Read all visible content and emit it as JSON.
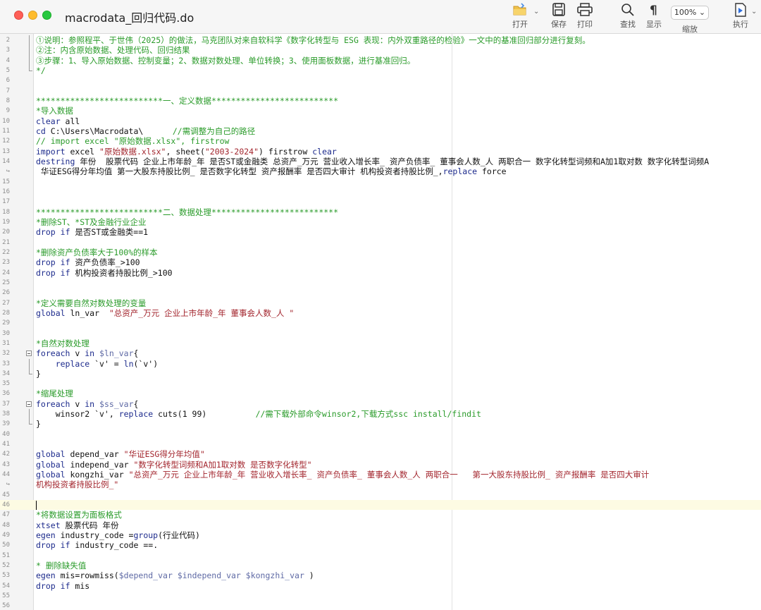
{
  "window": {
    "title": "macrodata_回归代码.do"
  },
  "toolbar": {
    "open": "打开",
    "save": "保存",
    "print": "打印",
    "find": "查找",
    "show": "显示",
    "zoom_label": "缩放",
    "zoom_value": "100%",
    "execute": "执行"
  },
  "lines": [
    {
      "n": "2",
      "segs": [
        {
          "t": "①说明：参照程平、于世伟（2025）的做法，马克团队对来自软科学《数字化转型与 ESG 表现：内外双重路径的检验》一文中的基准回归部分进行复刻。",
          "c": "c"
        }
      ]
    },
    {
      "n": "3",
      "segs": [
        {
          "t": "②注：内含原始数据、处理代码、回归结果",
          "c": "c"
        }
      ]
    },
    {
      "n": "4",
      "segs": [
        {
          "t": "③步骤：1、导入原始数据、控制变量；2、数据对数处理、单位转换；3、使用面板数据，进行基准回归。",
          "c": "c"
        }
      ]
    },
    {
      "n": "5",
      "segs": [
        {
          "t": "*/",
          "c": "c"
        }
      ]
    },
    {
      "n": "6",
      "segs": []
    },
    {
      "n": "7",
      "segs": []
    },
    {
      "n": "8",
      "segs": [
        {
          "t": "**************************一、定义数据**************************",
          "c": "c"
        }
      ]
    },
    {
      "n": "9",
      "segs": [
        {
          "t": "*导入数据",
          "c": "c"
        }
      ]
    },
    {
      "n": "10",
      "segs": [
        {
          "t": "clear",
          "c": "k"
        },
        {
          "t": " all",
          "c": "p"
        }
      ]
    },
    {
      "n": "11",
      "segs": [
        {
          "t": "cd",
          "c": "k"
        },
        {
          "t": " C:\\Users\\Macrodata\\      ",
          "c": "p"
        },
        {
          "t": "//需调整为自己的路径",
          "c": "c"
        }
      ]
    },
    {
      "n": "12",
      "segs": [
        {
          "t": "// import excel \"原始数据.xlsx\", firstrow",
          "c": "c"
        }
      ]
    },
    {
      "n": "13",
      "segs": [
        {
          "t": "import",
          "c": "k"
        },
        {
          "t": " excel ",
          "c": "p"
        },
        {
          "t": "\"原始数据.xlsx\"",
          "c": "s"
        },
        {
          "t": ", sheet(",
          "c": "p"
        },
        {
          "t": "\"2003-2024\"",
          "c": "s"
        },
        {
          "t": ") firstrow ",
          "c": "p"
        },
        {
          "t": "clear",
          "c": "k"
        }
      ]
    },
    {
      "n": "14",
      "segs": [
        {
          "t": "destring",
          "c": "k"
        },
        {
          "t": " 年份  股票代码 企业上市年龄_年 是否ST或金融类 总资产_万元 营业收入增长率_ 资产负债率_ 董事会人数_人 两职合一 数字化转型词频和A加1取对数 数字化转型词频A",
          "c": "p"
        }
      ]
    },
    {
      "n": "14",
      "segs": [
        {
          "t": " 华证ESG得分年均值 第一大股东持股比例_ 是否数字化转型 资产报酬率 是否四大审计 机构投资者持股比例_,",
          "c": "p"
        },
        {
          "t": "replace",
          "c": "k"
        },
        {
          "t": " force",
          "c": "p"
        }
      ]
    },
    {
      "n": "15",
      "segs": []
    },
    {
      "n": "16",
      "segs": []
    },
    {
      "n": "17",
      "segs": []
    },
    {
      "n": "18",
      "segs": [
        {
          "t": "**************************二、数据处理**************************",
          "c": "c"
        }
      ]
    },
    {
      "n": "19",
      "segs": [
        {
          "t": "*删除ST、*ST及金融行业企业",
          "c": "c"
        }
      ]
    },
    {
      "n": "20",
      "segs": [
        {
          "t": "drop",
          "c": "k"
        },
        {
          "t": " ",
          "c": "p"
        },
        {
          "t": "if",
          "c": "k"
        },
        {
          "t": " 是否ST或金融类==1",
          "c": "p"
        }
      ]
    },
    {
      "n": "21",
      "segs": []
    },
    {
      "n": "22",
      "segs": [
        {
          "t": "*删除资产负债率大于100%的样本",
          "c": "c"
        }
      ]
    },
    {
      "n": "23",
      "segs": [
        {
          "t": "drop",
          "c": "k"
        },
        {
          "t": " ",
          "c": "p"
        },
        {
          "t": "if",
          "c": "k"
        },
        {
          "t": " 资产负债率_>100",
          "c": "p"
        }
      ]
    },
    {
      "n": "24",
      "segs": [
        {
          "t": "drop",
          "c": "k"
        },
        {
          "t": " ",
          "c": "p"
        },
        {
          "t": "if",
          "c": "k"
        },
        {
          "t": " 机构投资者持股比例_>100",
          "c": "p"
        }
      ]
    },
    {
      "n": "25",
      "segs": []
    },
    {
      "n": "26",
      "segs": []
    },
    {
      "n": "27",
      "segs": [
        {
          "t": "*定义需要自然对数处理的变量",
          "c": "c"
        }
      ]
    },
    {
      "n": "28",
      "segs": [
        {
          "t": "global",
          "c": "k"
        },
        {
          "t": " ln_var  ",
          "c": "p"
        },
        {
          "t": "\"总资产_万元 企业上市年龄_年 董事会人数_人 \"",
          "c": "s"
        }
      ]
    },
    {
      "n": "29",
      "segs": []
    },
    {
      "n": "30",
      "segs": []
    },
    {
      "n": "31",
      "segs": [
        {
          "t": "*自然对数处理",
          "c": "c"
        }
      ]
    },
    {
      "n": "32",
      "segs": [
        {
          "t": "foreach",
          "c": "k"
        },
        {
          "t": " v ",
          "c": "p"
        },
        {
          "t": "in",
          "c": "k"
        },
        {
          "t": " ",
          "c": "p"
        },
        {
          "t": "$ln_var",
          "c": "m"
        },
        {
          "t": "{",
          "c": "p"
        }
      ]
    },
    {
      "n": "33",
      "segs": [
        {
          "t": "    ",
          "c": "p"
        },
        {
          "t": "replace",
          "c": "k"
        },
        {
          "t": " `v' = ",
          "c": "p"
        },
        {
          "t": "ln",
          "c": "k"
        },
        {
          "t": "(`v')",
          "c": "p"
        }
      ]
    },
    {
      "n": "34",
      "segs": [
        {
          "t": "}",
          "c": "p"
        }
      ]
    },
    {
      "n": "35",
      "segs": []
    },
    {
      "n": "36",
      "segs": [
        {
          "t": "*缩尾处理",
          "c": "c"
        }
      ]
    },
    {
      "n": "37",
      "segs": [
        {
          "t": "foreach",
          "c": "k"
        },
        {
          "t": " v ",
          "c": "p"
        },
        {
          "t": "in",
          "c": "k"
        },
        {
          "t": " ",
          "c": "p"
        },
        {
          "t": "$ss_var",
          "c": "m"
        },
        {
          "t": "{",
          "c": "p"
        }
      ]
    },
    {
      "n": "38",
      "segs": [
        {
          "t": "    winsor2 `v', ",
          "c": "p"
        },
        {
          "t": "replace",
          "c": "k"
        },
        {
          "t": " cuts(1 99)          ",
          "c": "p"
        },
        {
          "t": "//需下载外部命令winsor2,下载方式ssc install/findit",
          "c": "c"
        }
      ]
    },
    {
      "n": "39",
      "segs": [
        {
          "t": "}",
          "c": "p"
        }
      ]
    },
    {
      "n": "40",
      "segs": []
    },
    {
      "n": "41",
      "segs": []
    },
    {
      "n": "42",
      "segs": [
        {
          "t": "global",
          "c": "k"
        },
        {
          "t": " depend_var ",
          "c": "p"
        },
        {
          "t": "\"华证ESG得分年均值\"",
          "c": "s"
        }
      ]
    },
    {
      "n": "43",
      "segs": [
        {
          "t": "global",
          "c": "k"
        },
        {
          "t": " independ_var ",
          "c": "p"
        },
        {
          "t": "\"数字化转型词频和A加1取对数 是否数字化转型\"",
          "c": "s"
        }
      ]
    },
    {
      "n": "44",
      "segs": [
        {
          "t": "global",
          "c": "k"
        },
        {
          "t": " kongzhi_var ",
          "c": "p"
        },
        {
          "t": "\"总资产_万元 企业上市年龄_年 营业收入增长率_ 资产负债率_ 董事会人数_人 两职合一   第一大股东持股比例_ 资产报酬率 是否四大审计",
          "c": "s"
        }
      ]
    },
    {
      "n": "44",
      "segs": [
        {
          "t": "机构投资者持股比例_\"",
          "c": "s"
        }
      ]
    },
    {
      "n": "45",
      "segs": []
    },
    {
      "n": "46",
      "segs": [],
      "cursor": true
    },
    {
      "n": "47",
      "segs": [
        {
          "t": "*将数据设置为面板格式",
          "c": "c"
        }
      ]
    },
    {
      "n": "48",
      "segs": [
        {
          "t": "xtset",
          "c": "k"
        },
        {
          "t": " 股票代码 年份",
          "c": "p"
        }
      ]
    },
    {
      "n": "49",
      "segs": [
        {
          "t": "egen",
          "c": "k"
        },
        {
          "t": " industry_code =",
          "c": "p"
        },
        {
          "t": "group",
          "c": "k"
        },
        {
          "t": "(行业代码)",
          "c": "p"
        }
      ]
    },
    {
      "n": "50",
      "segs": [
        {
          "t": "drop",
          "c": "k"
        },
        {
          "t": " ",
          "c": "p"
        },
        {
          "t": "if",
          "c": "k"
        },
        {
          "t": " industry_code ==.",
          "c": "p"
        }
      ]
    },
    {
      "n": "51",
      "segs": []
    },
    {
      "n": "52",
      "segs": [
        {
          "t": "* 删除缺失值",
          "c": "c"
        }
      ]
    },
    {
      "n": "53",
      "segs": [
        {
          "t": "egen",
          "c": "k"
        },
        {
          "t": " mis=rowmiss(",
          "c": "p"
        },
        {
          "t": "$depend_var",
          "c": "m"
        },
        {
          "t": " ",
          "c": "p"
        },
        {
          "t": "$independ_var",
          "c": "m"
        },
        {
          "t": " ",
          "c": "p"
        },
        {
          "t": "$kongzhi_var",
          "c": "m"
        },
        {
          "t": " )",
          "c": "p"
        }
      ]
    },
    {
      "n": "54",
      "segs": [
        {
          "t": "drop",
          "c": "k"
        },
        {
          "t": " ",
          "c": "p"
        },
        {
          "t": "if",
          "c": "k"
        },
        {
          "t": " mis",
          "c": "p"
        }
      ]
    },
    {
      "n": "55",
      "segs": []
    },
    {
      "n": "56",
      "segs": []
    },
    {
      "n": "57",
      "segs": []
    }
  ]
}
